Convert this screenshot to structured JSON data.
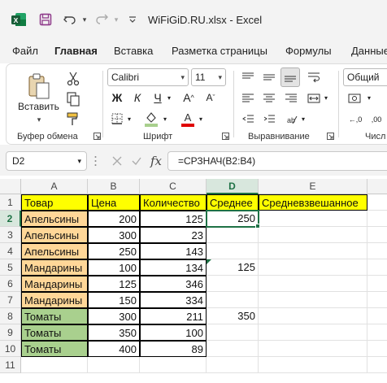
{
  "titlebar": {
    "title": "WiFiGiD.RU.xlsx  -  Excel",
    "icons": [
      "excel-logo-icon",
      "save-icon",
      "undo-icon",
      "redo-icon",
      "customize-qat-icon"
    ]
  },
  "tabs": [
    {
      "label": "Файл"
    },
    {
      "label": "Главная"
    },
    {
      "label": "Вставка"
    },
    {
      "label": "Разметка страницы"
    },
    {
      "label": "Формулы"
    },
    {
      "label": "Данные"
    }
  ],
  "ribbon": {
    "clipboard": {
      "paste_label": "Вставить",
      "group_label": "Буфер обмена"
    },
    "font": {
      "font_name": "Calibri",
      "font_size": "11",
      "group_label": "Шрифт"
    },
    "alignment": {
      "group_label": "Выравнивание"
    },
    "number": {
      "format": "Общий",
      "group_label": "Числ"
    }
  },
  "formula_bar": {
    "name_box": "D2",
    "fx": "fx",
    "formula": "=СРЗНАЧ(B2:B4)"
  },
  "columns": [
    "A",
    "B",
    "C",
    "D",
    "E"
  ],
  "rows": [
    "1",
    "2",
    "3",
    "4",
    "5",
    "6",
    "7",
    "8",
    "9",
    "10",
    "11"
  ],
  "sheet": {
    "header": [
      "Товар",
      "Цена",
      "Количество",
      "Среднее",
      "Средневзвешанное"
    ],
    "data": [
      [
        "Апельсины",
        "200",
        "125",
        "250"
      ],
      [
        "Апельсины",
        "300",
        "23",
        ""
      ],
      [
        "Апельсины",
        "250",
        "143",
        ""
      ],
      [
        "Мандарины",
        "100",
        "134",
        "125"
      ],
      [
        "Мандарины",
        "125",
        "346",
        ""
      ],
      [
        "Мандарины",
        "150",
        "334",
        ""
      ],
      [
        "Томаты",
        "300",
        "211",
        "350"
      ],
      [
        "Томаты",
        "350",
        "100",
        ""
      ],
      [
        "Томаты",
        "400",
        "89",
        ""
      ]
    ]
  },
  "colors": {
    "accent": "#1e7145",
    "header_fill": "#ffff00",
    "orange_fill": "#ffd798",
    "green_fill": "#a9d08e"
  }
}
